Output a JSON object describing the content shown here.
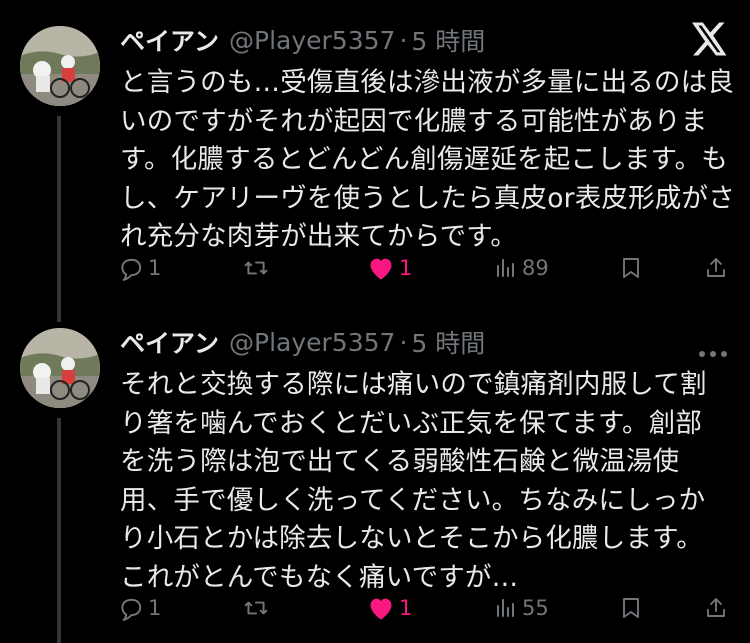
{
  "brand_logo": "x-logo",
  "tweets": [
    {
      "display_name": "ペイアン",
      "handle": "@Player5357",
      "separator": "·",
      "time": "5 時間",
      "text": "と言うのも…受傷直後は滲出液が多量に出るのは良\nいのですがそれが起因で化膿する可能性がありま\nす。化膿するとどんどん創傷遅延を起こします。も\nし、ケアリーヴを使うとしたら真皮or表皮形成がさ\nれ充分な肉芽が出来てからです。",
      "replies": "1",
      "retweets": "",
      "likes": "1",
      "views": "89",
      "liked": true
    },
    {
      "display_name": "ペイアン",
      "handle": "@Player5357",
      "separator": "·",
      "time": "5 時間",
      "text": "それと交換する際には痛いので鎮痛剤内服して割\nり箸を噛んでおくとだいぶ正気を保てます。創部\nを洗う際は泡で出てくる弱酸性石鹸と微温湯使\n用、手で優しく洗ってください。ちなみにしっか\nり小石とかは除去しないとそこから化膿します。\nこれがとんでもなく痛いですが…",
      "replies": "1",
      "retweets": "",
      "likes": "1",
      "views": "55",
      "liked": true
    }
  ],
  "colors": {
    "background": "#000000",
    "text": "#e7e9ea",
    "secondary": "#71767b",
    "like": "#f91880",
    "thread_line": "#333639"
  }
}
